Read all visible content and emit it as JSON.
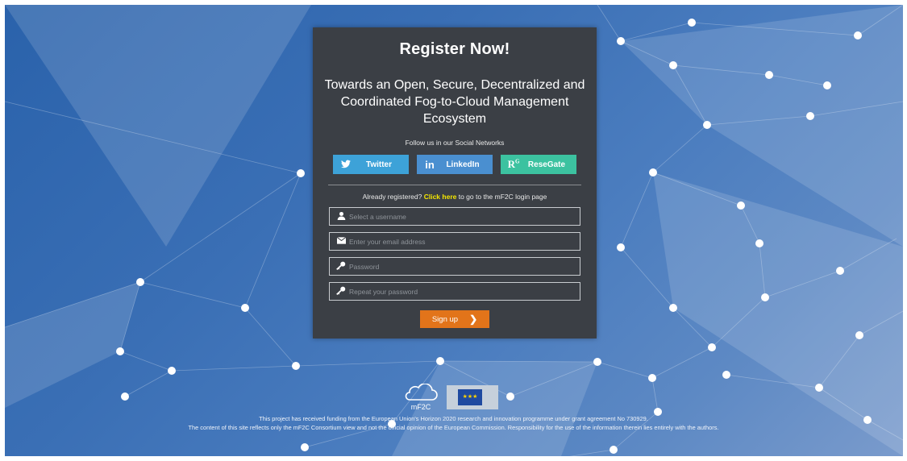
{
  "card": {
    "title": "Register Now!",
    "subtitle": "Towards an Open, Secure, Decentralized and Coordinated Fog-to-Cloud Management Ecosystem",
    "follow_text": "Follow us in our Social Networks",
    "social": [
      {
        "label": "Twitter",
        "icon": "twitter-icon",
        "color": "#3da2d8"
      },
      {
        "label": "LinkedIn",
        "icon": "linkedin-icon",
        "color": "#4a8fd0"
      },
      {
        "label": "ReseGate",
        "icon": "researchgate-icon",
        "color": "#3cc2a0"
      }
    ],
    "already_prefix": "Already registered?",
    "already_link": "Click here",
    "already_suffix": "to go to the mF2C login page",
    "fields": {
      "username_placeholder": "Select a username",
      "email_placeholder": "Enter your email address",
      "password_placeholder": "Password",
      "repeat_placeholder": "Repeat your password"
    },
    "signup_label": "Sign up"
  },
  "logos": {
    "mf2c_text": "mF2C"
  },
  "footer": {
    "line1": "This project has received funding from the European Union's Horizon 2020 research and innovation programme under grant agreement No 730929.",
    "line2": "The content of this site reflects only the mF2C Consortium view and not the official opinion of the European Commission. Responsibility for the use of the information therein lies entirely with the authors."
  },
  "colors": {
    "accent": "#e2741a",
    "link": "#f5e600",
    "card_bg": "#3b3f45"
  }
}
